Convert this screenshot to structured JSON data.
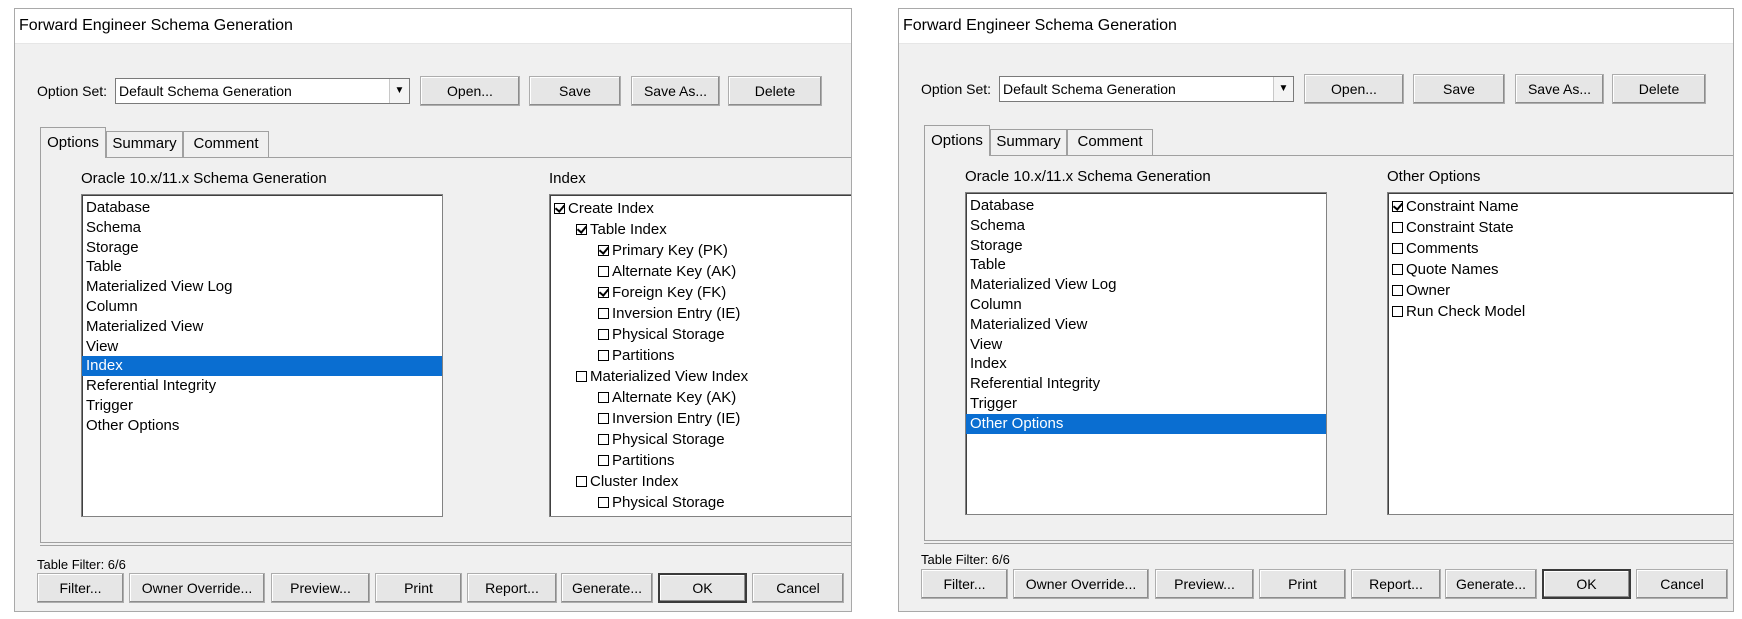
{
  "dialogs": [
    {
      "title": "Forward Engineer Schema Generation",
      "option_set_label": "Option Set:",
      "option_set_value": "Default Schema Generation",
      "top_buttons": [
        "Open...",
        "Save",
        "Save As...",
        "Delete"
      ],
      "tabs": [
        "Options",
        "Summary",
        "Comment"
      ],
      "active_tab": "Options",
      "left_list_label": "Oracle 10.x/11.x Schema Generation",
      "left_list_items": [
        "Database",
        "Schema",
        "Storage",
        "Table",
        "Materialized View Log",
        "Column",
        "Materialized View",
        "View",
        "Index",
        "Referential Integrity",
        "Trigger",
        "Other Options"
      ],
      "selected_item": "Index",
      "right_panel_label": "Index",
      "right_panel_items": [
        {
          "label": "Create Index",
          "checked": true,
          "level": 0
        },
        {
          "label": "Table Index",
          "checked": true,
          "level": 1
        },
        {
          "label": "Primary Key (PK)",
          "checked": true,
          "level": 2
        },
        {
          "label": "Alternate Key (AK)",
          "checked": false,
          "level": 2
        },
        {
          "label": "Foreign Key (FK)",
          "checked": true,
          "level": 2
        },
        {
          "label": "Inversion Entry (IE)",
          "checked": false,
          "level": 2
        },
        {
          "label": "Physical Storage",
          "checked": false,
          "level": 2
        },
        {
          "label": "Partitions",
          "checked": false,
          "level": 2
        },
        {
          "label": "Materialized View Index",
          "checked": false,
          "level": 1
        },
        {
          "label": "Alternate Key (AK)",
          "checked": false,
          "level": 2
        },
        {
          "label": "Inversion Entry (IE)",
          "checked": false,
          "level": 2
        },
        {
          "label": "Physical Storage",
          "checked": false,
          "level": 2
        },
        {
          "label": "Partitions",
          "checked": false,
          "level": 2
        },
        {
          "label": "Cluster Index",
          "checked": false,
          "level": 1
        },
        {
          "label": "Physical Storage",
          "checked": false,
          "level": 2
        }
      ],
      "table_filter": "Table Filter: 6/6",
      "bottom_buttons": [
        "Filter...",
        "Owner Override...",
        "Preview...",
        "Print",
        "Report...",
        "Generate...",
        "OK",
        "Cancel"
      ]
    },
    {
      "title": "Forward Engineer Schema Generation",
      "option_set_label": "Option Set:",
      "option_set_value": "Default Schema Generation",
      "top_buttons": [
        "Open...",
        "Save",
        "Save As...",
        "Delete"
      ],
      "tabs": [
        "Options",
        "Summary",
        "Comment"
      ],
      "active_tab": "Options",
      "left_list_label": "Oracle 10.x/11.x Schema Generation",
      "left_list_items": [
        "Database",
        "Schema",
        "Storage",
        "Table",
        "Materialized View Log",
        "Column",
        "Materialized View",
        "View",
        "Index",
        "Referential Integrity",
        "Trigger",
        "Other Options"
      ],
      "selected_item": "Other Options",
      "right_panel_label": "Other Options",
      "right_panel_items": [
        {
          "label": "Constraint Name",
          "checked": true,
          "level": 0
        },
        {
          "label": "Constraint State",
          "checked": false,
          "level": 0
        },
        {
          "label": "Comments",
          "checked": false,
          "level": 0
        },
        {
          "label": "Quote Names",
          "checked": false,
          "level": 0
        },
        {
          "label": "Owner",
          "checked": false,
          "level": 0
        },
        {
          "label": "Run Check Model",
          "checked": false,
          "level": 0
        }
      ],
      "table_filter": "Table Filter: 6/6",
      "bottom_buttons": [
        "Filter...",
        "Owner Override...",
        "Preview...",
        "Print",
        "Report...",
        "Generate...",
        "OK",
        "Cancel"
      ]
    }
  ],
  "icons": {
    "combo_arrow": "chevron-down-icon",
    "checkbox": "checkbox-icon"
  }
}
